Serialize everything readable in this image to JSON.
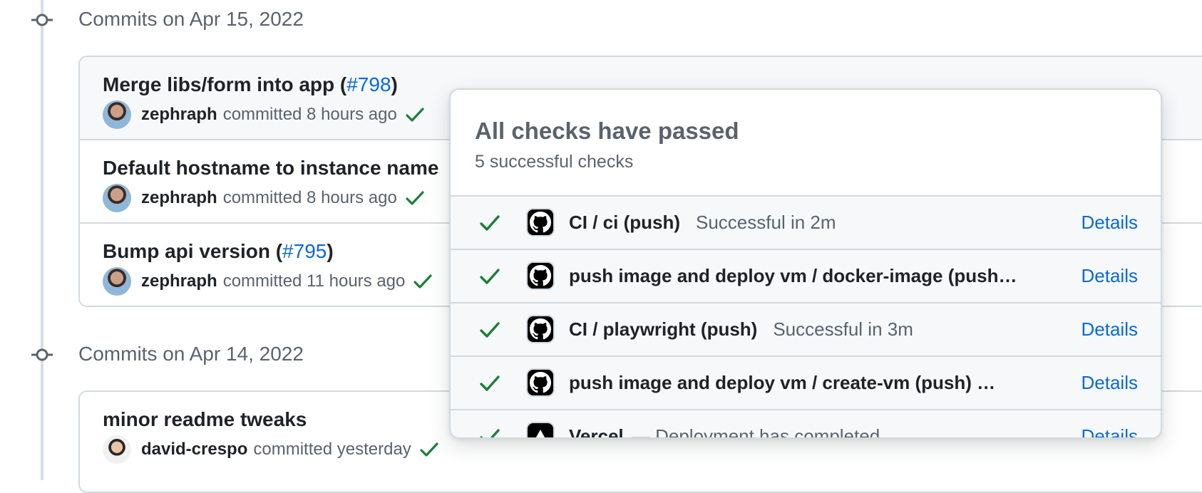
{
  "groups": [
    {
      "heading": "Commits on Apr 15, 2022",
      "commits": [
        {
          "title": "Merge libs/form into app (",
          "pr": "#798",
          "title_end": ")",
          "author": "zephraph",
          "time": "committed 8 hours ago"
        },
        {
          "title": "Default hostname to instance name",
          "pr": "",
          "title_end": "",
          "author": "zephraph",
          "time": "committed 8 hours ago"
        },
        {
          "title": "Bump api version (",
          "pr": "#795",
          "title_end": ")",
          "author": "zephraph",
          "time": "committed 11 hours ago"
        }
      ]
    },
    {
      "heading": "Commits on Apr 14, 2022",
      "commits": [
        {
          "title": "minor readme tweaks",
          "pr": "",
          "title_end": "",
          "author": "david-crespo",
          "time": "committed yesterday"
        }
      ]
    }
  ],
  "popover": {
    "title": "All checks have passed",
    "subtitle": "5 successful checks",
    "checks": [
      {
        "name": "CI / ci (push)",
        "status": "Successful in 2m",
        "details": "Details",
        "icon": "github-icon"
      },
      {
        "name": "push image and deploy vm / docker-image (push…",
        "status": "",
        "details": "Details",
        "icon": "github-icon"
      },
      {
        "name": "CI / playwright (push)",
        "status": "Successful in 3m",
        "details": "Details",
        "icon": "github-icon"
      },
      {
        "name": "push image and deploy vm / create-vm (push) …",
        "status": "",
        "details": "Details",
        "icon": "github-icon"
      },
      {
        "name": "Vercel",
        "status": "— Deployment has completed",
        "details": "Details",
        "icon": "vercel-icon"
      }
    ]
  },
  "colors": {
    "success": "#1a7f37",
    "link": "#0969da",
    "muted": "#59636e",
    "border": "#d1d9e0"
  }
}
